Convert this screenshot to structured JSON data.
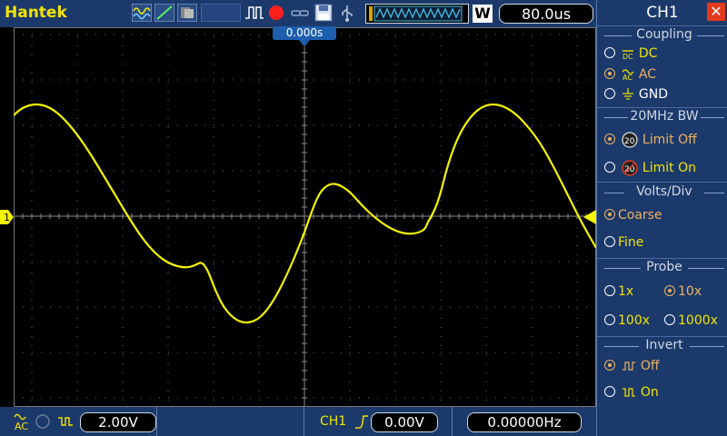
{
  "topbar": {
    "brand": "Hantek",
    "timebase": "80.0us",
    "mode_label": "W"
  },
  "screen": {
    "trigger_position": "0.000s",
    "channel_marker": "1"
  },
  "bottombar": {
    "coupling_icon": "ac-coupling-icon",
    "volts_div": "2.00V",
    "trigger_source": "CH1",
    "trigger_level": "0.00V",
    "frequency": "0.00000Hz"
  },
  "panel": {
    "title": "CH1",
    "coupling_title": "Coupling",
    "coupling_options": [
      "DC",
      "AC",
      "GND"
    ],
    "bw_title": "20MHz BW",
    "bw_options": [
      "Limit Off",
      "Limit On"
    ],
    "volts_title": "Volts/Div",
    "volts_options": [
      "Coarse",
      "Fine"
    ],
    "probe_title": "Probe",
    "probe_options": [
      "1x",
      "10x",
      "100x",
      "1000x"
    ],
    "invert_title": "Invert",
    "invert_options": [
      "Off",
      "On"
    ]
  },
  "colors": {
    "trace": "#f5f500",
    "panel_bg": "#1b3a6b",
    "selected_option": "#f0b060"
  }
}
